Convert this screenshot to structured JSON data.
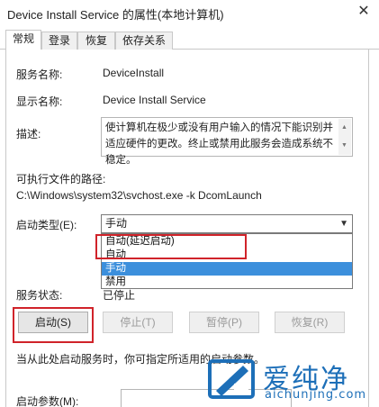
{
  "window": {
    "title": "Device Install Service 的属性(本地计算机)",
    "close_glyph": "✕"
  },
  "tabs": [
    {
      "label": "常规",
      "active": true
    },
    {
      "label": "登录",
      "active": false
    },
    {
      "label": "恢复",
      "active": false
    },
    {
      "label": "依存关系",
      "active": false
    }
  ],
  "general": {
    "service_name_label": "服务名称:",
    "service_name_value": "DeviceInstall",
    "display_name_label": "显示名称:",
    "display_name_value": "Device Install Service",
    "description_label": "描述:",
    "description_value": "使计算机在极少或没有用户输入的情况下能识别并适应硬件的更改。终止或禁用此服务会造成系统不稳定。",
    "exe_path_label": "可执行文件的路径:",
    "exe_path_value": "C:\\Windows\\system32\\svchost.exe -k DcomLaunch",
    "startup_type_label": "启动类型(E):",
    "startup_type_value": "手动",
    "startup_options": [
      {
        "label": "自动(延迟启动)",
        "selected": false
      },
      {
        "label": "自动",
        "selected": false
      },
      {
        "label": "手动",
        "selected": true
      },
      {
        "label": "禁用",
        "selected": false
      }
    ],
    "status_label": "服务状态:",
    "status_value": "已停止",
    "buttons": {
      "start": "启动(S)",
      "stop": "停止(T)",
      "pause": "暂停(P)",
      "resume": "恢复(R)"
    },
    "hint_text": "当从此处启动服务时，你可指定所适用的启动参数。",
    "params_label": "启动参数(M):"
  },
  "watermark": {
    "brand": "爱纯净",
    "url": "aichunjing.com"
  },
  "colors": {
    "highlight": "#d0232a",
    "selection": "#3c8fdc",
    "brand": "#1d6fb8"
  }
}
